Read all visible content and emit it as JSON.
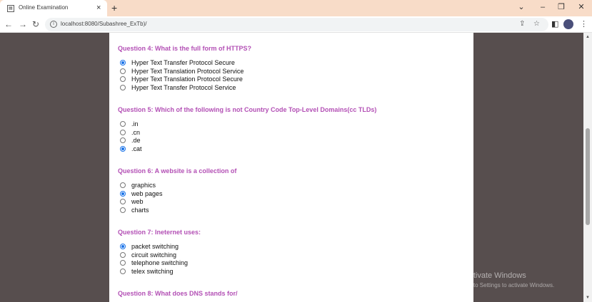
{
  "browser": {
    "tab_title": "Online Examination",
    "tab_close": "×",
    "new_tab": "+",
    "window_controls": {
      "chevron": "⌄",
      "minimize": "–",
      "restore": "❐",
      "close": "✕"
    },
    "nav": {
      "back": "←",
      "forward": "→",
      "reload": "↻"
    },
    "info_glyph": "i",
    "url": "localhost:8080/Subashree_ExTb)/",
    "share_glyph": "⇪",
    "star_glyph": "☆",
    "sidebar_glyph": "◧",
    "menu_glyph": "⋮"
  },
  "questions": [
    {
      "title": "Question 4: What is the full form of HTTPS?",
      "options": [
        {
          "label": "Hyper Text Transfer Protocol Secure",
          "checked": true
        },
        {
          "label": "Hyper Text Translation Protocol Service",
          "checked": false
        },
        {
          "label": "Hyper Text Translation Protocol Secure",
          "checked": false
        },
        {
          "label": "Hyper Text Transfer Protocol Service",
          "checked": false
        }
      ]
    },
    {
      "title": "Question 5: Which of the following is not Country Code Top-Level Domains(cc TLDs)",
      "options": [
        {
          "label": ".in",
          "checked": false
        },
        {
          "label": ".cn",
          "checked": false
        },
        {
          "label": ".de",
          "checked": false
        },
        {
          "label": ".cat",
          "checked": true
        }
      ]
    },
    {
      "title": "Question 6: A website is a collection of",
      "options": [
        {
          "label": "graphics",
          "checked": false
        },
        {
          "label": "web pages",
          "checked": true
        },
        {
          "label": "web",
          "checked": false
        },
        {
          "label": "charts",
          "checked": false
        }
      ]
    },
    {
      "title": "Question 7: Ineternet uses:",
      "options": [
        {
          "label": "packet switching",
          "checked": true
        },
        {
          "label": "circuit switching",
          "checked": false
        },
        {
          "label": "telephone switching",
          "checked": false
        },
        {
          "label": "telex switching",
          "checked": false
        }
      ]
    },
    {
      "title": "Question 8: What does DNS stands for/",
      "options": []
    }
  ],
  "scrollbar": {
    "up": "▲",
    "down": "▼"
  },
  "watermark": {
    "title": "Activate Windows",
    "subtitle": "Go to Settings to activate Windows."
  }
}
